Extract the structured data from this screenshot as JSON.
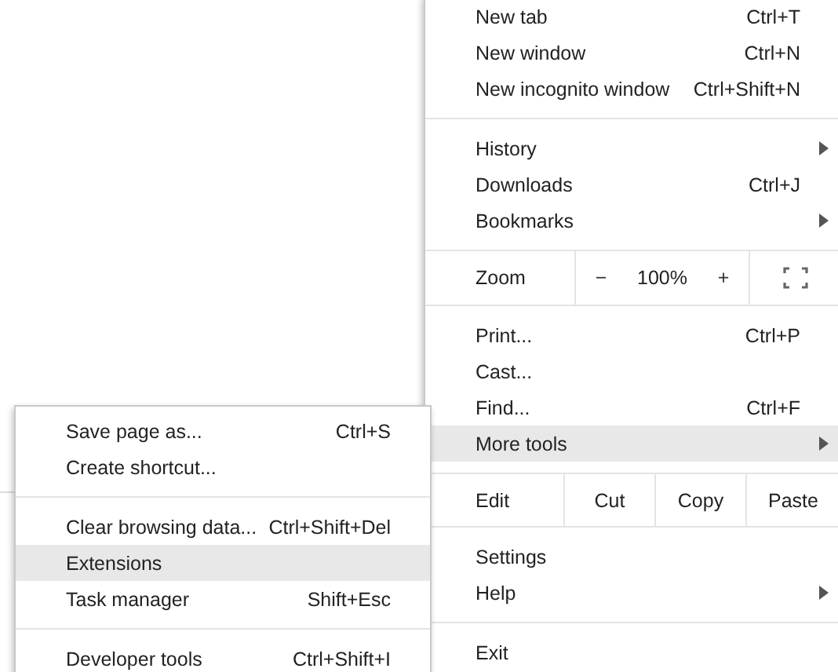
{
  "main_menu": {
    "sections": [
      {
        "kind": "items",
        "items": [
          {
            "label": "New tab",
            "shortcut": "Ctrl+T",
            "has_submenu": false,
            "selected": false
          },
          {
            "label": "New window",
            "shortcut": "Ctrl+N",
            "has_submenu": false,
            "selected": false
          },
          {
            "label": "New incognito window",
            "shortcut": "Ctrl+Shift+N",
            "has_submenu": false,
            "selected": false
          }
        ]
      },
      {
        "kind": "items",
        "items": [
          {
            "label": "History",
            "has_submenu": true,
            "selected": false
          },
          {
            "label": "Downloads",
            "shortcut": "Ctrl+J",
            "has_submenu": false,
            "selected": false
          },
          {
            "label": "Bookmarks",
            "has_submenu": true,
            "selected": false
          }
        ]
      },
      {
        "kind": "zoom",
        "label": "Zoom",
        "minus": "−",
        "value": "100%",
        "plus": "+"
      },
      {
        "kind": "items",
        "items": [
          {
            "label": "Print...",
            "shortcut": "Ctrl+P",
            "has_submenu": false,
            "selected": false
          },
          {
            "label": "Cast...",
            "has_submenu": false,
            "selected": false
          },
          {
            "label": "Find...",
            "shortcut": "Ctrl+F",
            "has_submenu": false,
            "selected": false
          },
          {
            "label": "More tools",
            "has_submenu": true,
            "selected": true
          }
        ]
      },
      {
        "kind": "edit",
        "label": "Edit",
        "buttons": [
          "Cut",
          "Copy",
          "Paste"
        ]
      },
      {
        "kind": "items",
        "items": [
          {
            "label": "Settings",
            "has_submenu": false,
            "selected": false
          },
          {
            "label": "Help",
            "has_submenu": true,
            "selected": false
          }
        ]
      },
      {
        "kind": "items",
        "items": [
          {
            "label": "Exit",
            "has_submenu": false,
            "selected": false
          }
        ]
      }
    ]
  },
  "submenu": {
    "sections": [
      {
        "kind": "items",
        "items": [
          {
            "label": "Save page as...",
            "shortcut": "Ctrl+S",
            "has_submenu": false,
            "selected": false
          },
          {
            "label": "Create shortcut...",
            "has_submenu": false,
            "selected": false
          }
        ]
      },
      {
        "kind": "items",
        "items": [
          {
            "label": "Clear browsing data...",
            "shortcut": "Ctrl+Shift+Del",
            "has_submenu": false,
            "selected": false
          },
          {
            "label": "Extensions",
            "has_submenu": false,
            "selected": true
          },
          {
            "label": "Task manager",
            "shortcut": "Shift+Esc",
            "has_submenu": false,
            "selected": false
          }
        ]
      },
      {
        "kind": "items",
        "items": [
          {
            "label": "Developer tools",
            "shortcut": "Ctrl+Shift+I",
            "has_submenu": false,
            "selected": false
          }
        ]
      }
    ]
  }
}
